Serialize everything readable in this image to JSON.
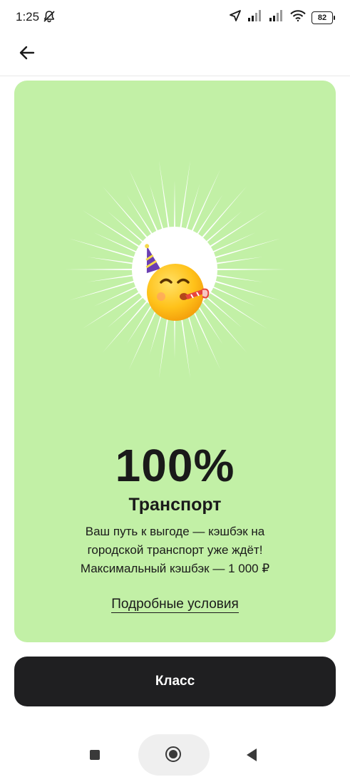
{
  "status_bar": {
    "time": "1:25",
    "battery": "82",
    "icons": [
      "notifications-off-icon",
      "location-arrow-icon",
      "signal-icon",
      "signal-icon",
      "wifi-icon",
      "battery-icon"
    ]
  },
  "app_bar": {
    "back_icon": "arrow-left-icon"
  },
  "promo": {
    "background_color": "#c2f0a6",
    "emoji": "party-face-emoji",
    "percent": "100%",
    "category": "Транспорт",
    "description_lines": [
      "Ваш путь к выгоде — кэшбэк на",
      "городской транспорт уже ждёт!",
      "Максимальный кэшбэк — 1 000 ₽"
    ],
    "terms_link": "Подробные условия"
  },
  "primary_button": {
    "label": "Класс",
    "color": "#1f1f21"
  },
  "nav_bar": {
    "icons": [
      "recents-square-icon",
      "home-circle-icon",
      "back-triangle-icon"
    ]
  }
}
